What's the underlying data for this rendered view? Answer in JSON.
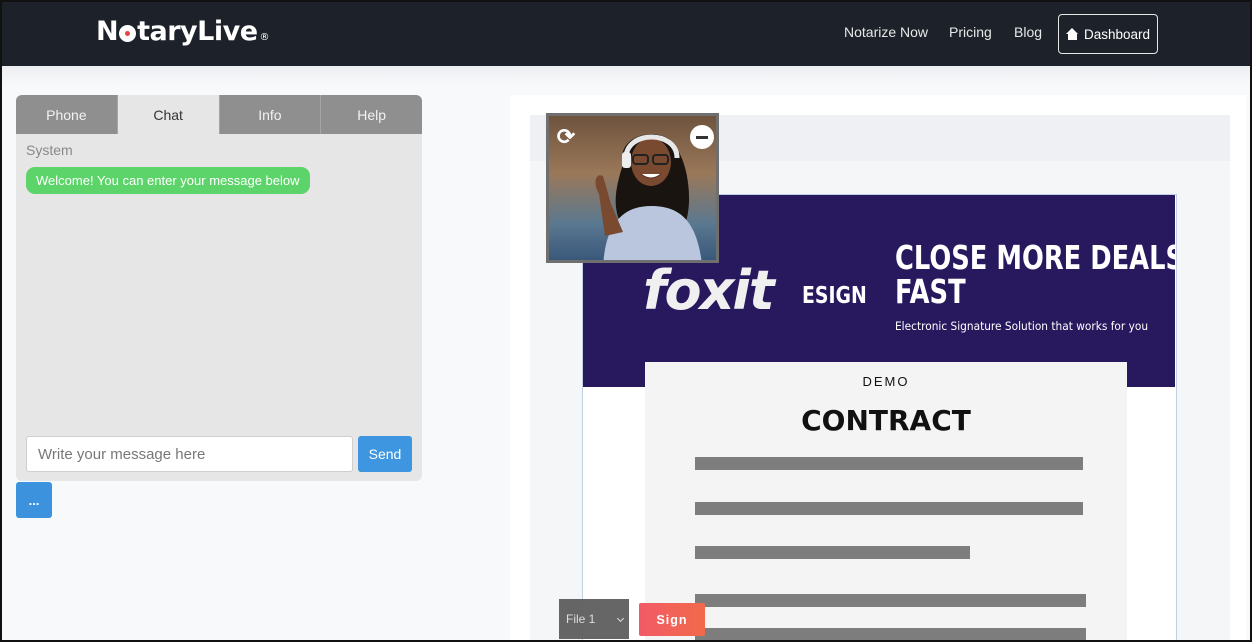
{
  "navbar": {
    "logo_text": "NotaryLive",
    "links": [
      "Notarize Now",
      "Pricing",
      "Blog"
    ],
    "dashboard_label": "Dashboard"
  },
  "chat_panel": {
    "tabs": [
      {
        "label": "Phone",
        "active": false
      },
      {
        "label": "Chat",
        "active": true
      },
      {
        "label": "Info",
        "active": false
      },
      {
        "label": "Help",
        "active": false
      }
    ],
    "sender_label": "System",
    "messages": [
      {
        "text": "Welcome! You can enter your message below",
        "color": "#5cd46a"
      }
    ],
    "input_placeholder": "Write your message here",
    "send_label": "Send",
    "more_label": "..."
  },
  "document": {
    "brand": "foxit",
    "brand_suffix": "ESIGN",
    "headline_line1": "CLOSE MORE DEALS,",
    "headline_line2": "FAST",
    "subheadline": "Electronic Signature Solution that works for you",
    "demo_label": "DEMO",
    "title": "CONTRACT",
    "banner_color": "#28195f"
  },
  "video": {
    "refresh_icon": "refresh-icon",
    "minimize_icon": "minimize-icon"
  },
  "controls": {
    "file_selected": "File 1",
    "sign_label": "Sign"
  }
}
